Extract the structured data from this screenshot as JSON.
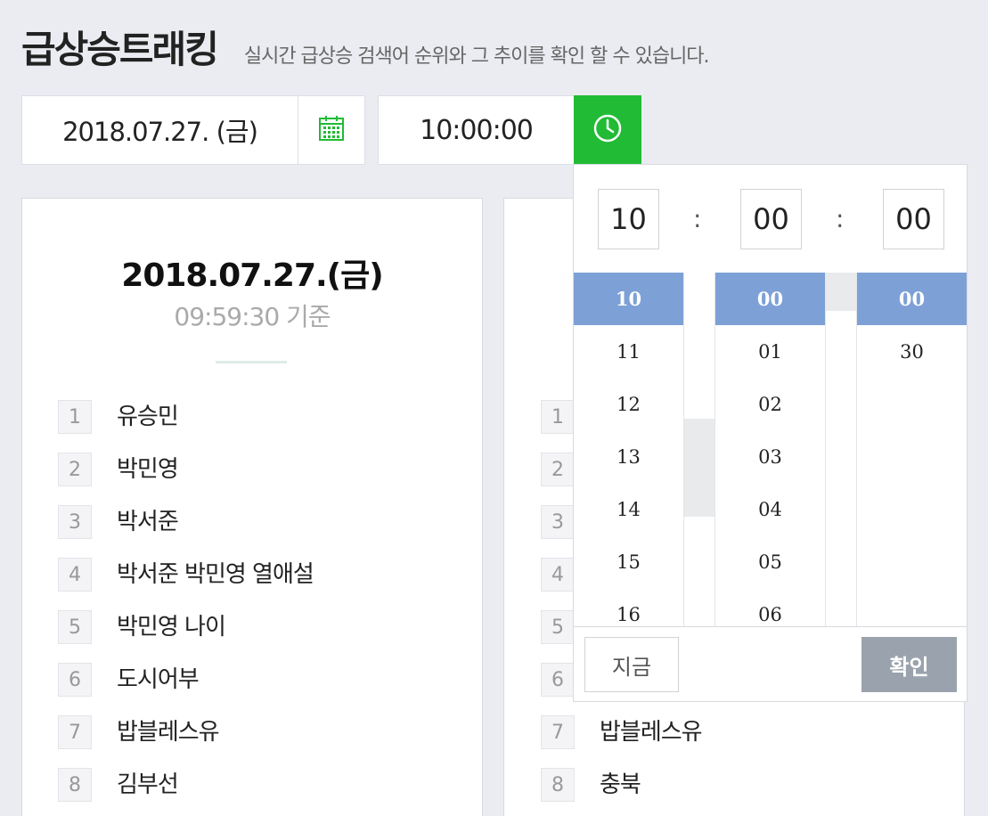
{
  "header": {
    "title": "급상승트래킹",
    "subtitle": "실시간 급상승 검색어 순위와 그 추이를 확인 할 수 있습니다."
  },
  "controls": {
    "date_value": "2018.07.27. (금)",
    "time_value": "10:00:00",
    "calendar_icon": "calendar-icon",
    "clock_icon": "clock-icon",
    "accent_color": "#21bb35"
  },
  "left_card": {
    "date": "2018.07.27.(금)",
    "basis": "09:59:30 기준",
    "ranks": [
      {
        "num": "1",
        "keyword": "유승민"
      },
      {
        "num": "2",
        "keyword": "박민영"
      },
      {
        "num": "3",
        "keyword": "박서준"
      },
      {
        "num": "4",
        "keyword": "박서준 박민영 열애설"
      },
      {
        "num": "5",
        "keyword": "박민영 나이"
      },
      {
        "num": "6",
        "keyword": "도시어부"
      },
      {
        "num": "7",
        "keyword": "밥블레스유"
      },
      {
        "num": "8",
        "keyword": "김부선"
      }
    ]
  },
  "right_card": {
    "ranks": [
      {
        "num": "1",
        "keyword": ""
      },
      {
        "num": "2",
        "keyword": ""
      },
      {
        "num": "3",
        "keyword": ""
      },
      {
        "num": "4",
        "keyword": ""
      },
      {
        "num": "5",
        "keyword": ""
      },
      {
        "num": "6",
        "keyword": ""
      },
      {
        "num": "7",
        "keyword": "밥블레스유"
      },
      {
        "num": "8",
        "keyword": "충북"
      }
    ]
  },
  "time_picker": {
    "hour": "10",
    "minute": "00",
    "second": "00",
    "separator": ":",
    "hours": [
      "10",
      "11",
      "12",
      "13",
      "14",
      "15",
      "16"
    ],
    "minutes": [
      "00",
      "01",
      "02",
      "03",
      "04",
      "05",
      "06"
    ],
    "seconds": [
      "00",
      "30"
    ],
    "now_label": "지금",
    "confirm_label": "확인",
    "selected_color": "#7da1d6"
  }
}
